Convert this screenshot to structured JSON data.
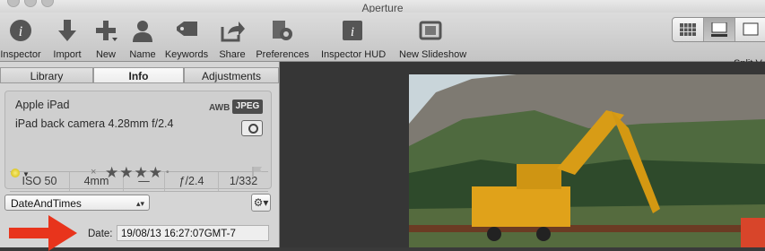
{
  "app": {
    "title": "Aperture"
  },
  "toolbar": {
    "buttons": [
      {
        "id": "inspector",
        "label": "Inspector",
        "icon": "info-circle-icon"
      },
      {
        "id": "import",
        "label": "Import",
        "icon": "import-arrow-icon"
      },
      {
        "id": "new",
        "label": "New",
        "icon": "plus-icon"
      },
      {
        "id": "name",
        "label": "Name",
        "icon": "person-icon"
      },
      {
        "id": "keywords",
        "label": "Keywords",
        "icon": "tag-icon"
      },
      {
        "id": "share",
        "label": "Share",
        "icon": "share-icon"
      },
      {
        "id": "preferences",
        "label": "Preferences",
        "icon": "gear-icon"
      },
      {
        "id": "inspector_hud",
        "label": "Inspector HUD",
        "icon": "info-hud-icon"
      },
      {
        "id": "new_slideshow",
        "label": "New Slideshow",
        "icon": "slideshow-icon"
      }
    ],
    "split_view_label": "Split V"
  },
  "inspector": {
    "tabs": [
      "Library",
      "Info",
      "Adjustments"
    ],
    "active_tab": "Info",
    "camera": {
      "model": "Apple iPad",
      "lens": "iPad back camera 4.28mm f/2.4",
      "white_balance": "AWB",
      "format": "JPEG",
      "iso": "ISO 50",
      "focal_length": "4mm",
      "exposure_bias": "—",
      "aperture": "ƒ/2.4",
      "shutter": "1/332"
    },
    "rating": {
      "stars_text": "★★★★",
      "reject_text": "×",
      "extra_text": "•"
    },
    "metadata_view": {
      "selected": "DateAndTimes"
    },
    "date_field": {
      "label": "Date:",
      "value": "19/08/13 16:27:07GMT-7"
    }
  },
  "colors": {
    "annotation_arrow": "#e8341c",
    "label_dot": "#e6d21e"
  }
}
